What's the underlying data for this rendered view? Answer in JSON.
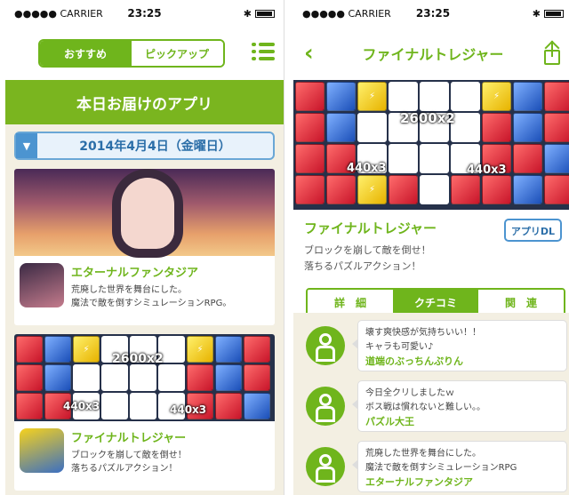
{
  "left": {
    "status": {
      "carrier": "●●●●● CARRIER",
      "time": "23:25",
      "bluetooth": "✱"
    },
    "segments": [
      "おすすめ",
      "ピックアップ"
    ],
    "menu_icon": "list-menu-icon",
    "hero_title": "本日お届けのアプリ",
    "date_label": "2014年4月4日（金曜日）",
    "apps": [
      {
        "name": "エターナルファンタジア",
        "desc1": "荒廃した世界を舞台にした。",
        "desc2": "魔法で敵を倒すシミュレーションRPG。"
      },
      {
        "name": "ファイナルトレジャー",
        "desc1": "ブロックを崩して敵を倒せ！",
        "desc2": "落ちるパズルアクション！"
      }
    ],
    "puzzle_scores": [
      "2600x2",
      "440x3",
      "440x3"
    ]
  },
  "right": {
    "status": {
      "carrier": "●●●●● CARRIER",
      "time": "23:25",
      "bluetooth": "✱"
    },
    "nav_title": "ファイナルトレジャー",
    "back_glyph": "‹",
    "app_name": "ファイナルトレジャー",
    "dl_label": "アプリDL",
    "desc1": "ブロックを崩して敵を倒せ！",
    "desc2": "落ちるパズルアクション！",
    "tabs": [
      "詳　細",
      "クチコミ",
      "関　連"
    ],
    "puzzle_scores": [
      "2600x2",
      "440x3",
      "440x3"
    ],
    "reviews": [
      {
        "line1": "壊す爽快感が気持ちいい！！",
        "line2": "キャラも可愛い♪",
        "user": "道端のぶっちんぷりん"
      },
      {
        "line1": "今日全クリしましたｗ",
        "line2": "ボス戦は慣れないと難しい。。",
        "user": "パズル大王"
      },
      {
        "line1": "荒廃した世界を舞台にした。",
        "line2": "魔法で敵を倒すシミュレーションRPG",
        "user": "エターナルファンタジア"
      }
    ]
  },
  "colors": {
    "accent_green": "#6fb51c",
    "accent_blue": "#4c94d0",
    "feed_bg": "#f3efe2"
  }
}
